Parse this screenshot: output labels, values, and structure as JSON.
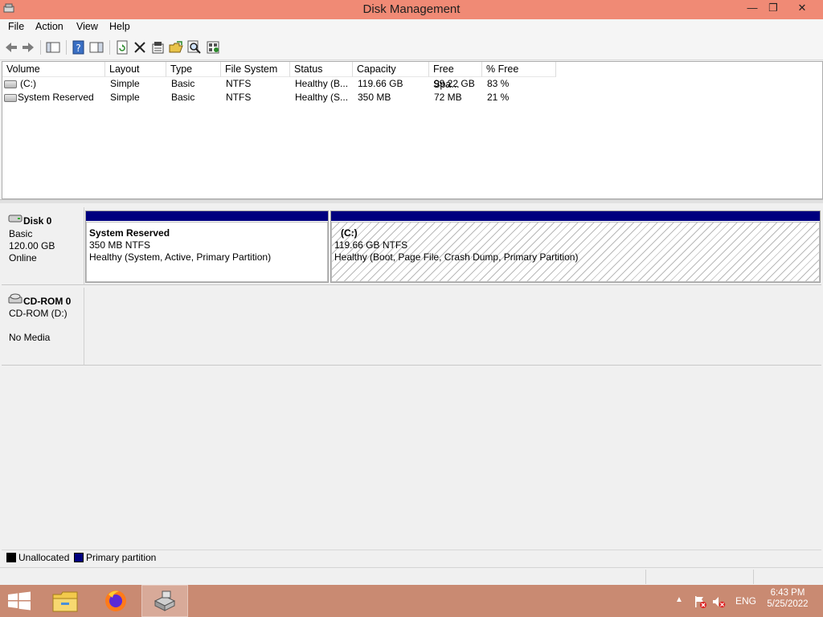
{
  "window": {
    "title": "Disk Management",
    "minimize": "—",
    "restore": "❐",
    "close": "✕"
  },
  "menu": [
    "File",
    "Action",
    "View",
    "Help"
  ],
  "toolbar": {
    "icons": [
      "back-icon",
      "forward-icon",
      "show-hide-console-tree-icon",
      "help-icon",
      "properties-pane-icon",
      "refresh-icon",
      "delete-icon",
      "properties-icon",
      "open-icon",
      "search-icon",
      "settings-icon"
    ]
  },
  "volume_list": {
    "columns": [
      "Volume",
      "Layout",
      "Type",
      "File System",
      "Status",
      "Capacity",
      "Free Spa...",
      "% Free"
    ],
    "rows": [
      {
        "volume": "(C:)",
        "layout": "Simple",
        "type": "Basic",
        "fs": "NTFS",
        "status": "Healthy (B...",
        "capacity": "119.66 GB",
        "free": "99.22 GB",
        "pct": "83 %"
      },
      {
        "volume": "System Reserved",
        "layout": "Simple",
        "type": "Basic",
        "fs": "NTFS",
        "status": "Healthy (S...",
        "capacity": "350 MB",
        "free": "72 MB",
        "pct": "21 %"
      }
    ]
  },
  "disks": [
    {
      "name": "Disk 0",
      "line1": "Basic",
      "line2": "120.00 GB",
      "line3": "Online",
      "partitions": [
        {
          "title": "System Reserved",
          "size": "350 MB NTFS",
          "status": "Healthy (System, Active, Primary Partition)"
        },
        {
          "title": "(C:)",
          "size": "119.66 GB NTFS",
          "status": "Healthy (Boot, Page File, Crash Dump, Primary Partition)"
        }
      ]
    },
    {
      "name": "CD-ROM 0",
      "line1": "CD-ROM (D:)",
      "line2": "",
      "line3": "No Media"
    }
  ],
  "legend": {
    "unallocated": "Unallocated",
    "primary": "Primary partition"
  },
  "colors": {
    "title_bar": "#f08a75",
    "primary_partition": "#00007f",
    "unallocated": "#000000",
    "taskbar": "#c98a72"
  },
  "taskbar": {
    "items": [
      "start-button",
      "file-explorer",
      "firefox",
      "disk-management"
    ],
    "tray": {
      "language": "ENG",
      "time": "6:43 PM",
      "date": "5/25/2022"
    }
  }
}
